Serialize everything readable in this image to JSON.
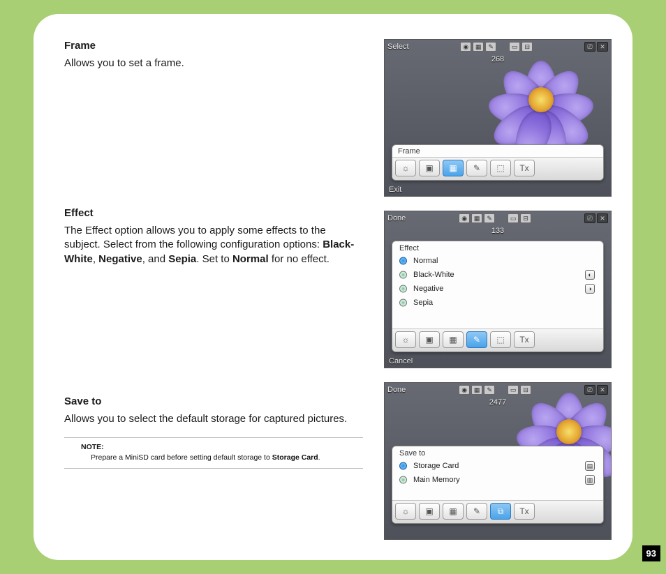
{
  "page_number": "93",
  "sections": {
    "frame": {
      "heading": "Frame",
      "body": "Allows you to set a frame."
    },
    "effect": {
      "heading": "Effect",
      "body_pre": "The Effect option allows you to apply some effects to the subject. Select from the following configuration options: ",
      "opt1": "Black-White",
      "sep1": ", ",
      "opt2": "Negative",
      "sep2": ", and ",
      "opt3": "Sepia",
      "mid": ". Set to ",
      "opt4": "Normal",
      "tail": " for no effect."
    },
    "saveto": {
      "heading": "Save to",
      "body": "Allows you to select the default storage for captured pictures.",
      "note_label": "NOTE:",
      "note_text_pre": "Prepare a MiniSD card before setting default storage to ",
      "note_bold": "Storage Card",
      "note_tail": "."
    }
  },
  "shots": {
    "frame": {
      "top_left": "Select",
      "bottom_left": "Exit",
      "counter": "268",
      "panel_title": "Frame",
      "tool_icons": [
        "☼",
        "▣",
        "▦",
        "✎",
        "⬚",
        "Tx"
      ],
      "selected_tool_index": 2
    },
    "effect": {
      "top_left": "Done",
      "bottom_left": "Cancel",
      "counter": "133",
      "panel_title": "Effect",
      "options": [
        "Normal",
        "Black-White",
        "Negative",
        "Sepia"
      ],
      "selected_index": 0,
      "right_icons": [
        "",
        "◐",
        "◑",
        ""
      ],
      "bottom_tools": [
        "☼",
        "▣",
        "▦",
        "✎",
        "⬚",
        "Tx"
      ],
      "bottom_selected_index": 3
    },
    "saveto": {
      "top_left": "Done",
      "bottom_left": "",
      "counter": "2477",
      "panel_title": "Save to",
      "options": [
        "Storage Card",
        "Main Memory"
      ],
      "selected_index": 0,
      "right_icons": [
        "▤",
        "▥"
      ],
      "bottom_tools": [
        "☼",
        "▣",
        "▦",
        "✎",
        "⧉",
        "Tx"
      ],
      "bottom_selected_index": 4
    },
    "common_top_icons": [
      "◉",
      "▦",
      "✎",
      "▭",
      "⊟"
    ],
    "common_top_right": [
      "⎚",
      "✕"
    ]
  }
}
